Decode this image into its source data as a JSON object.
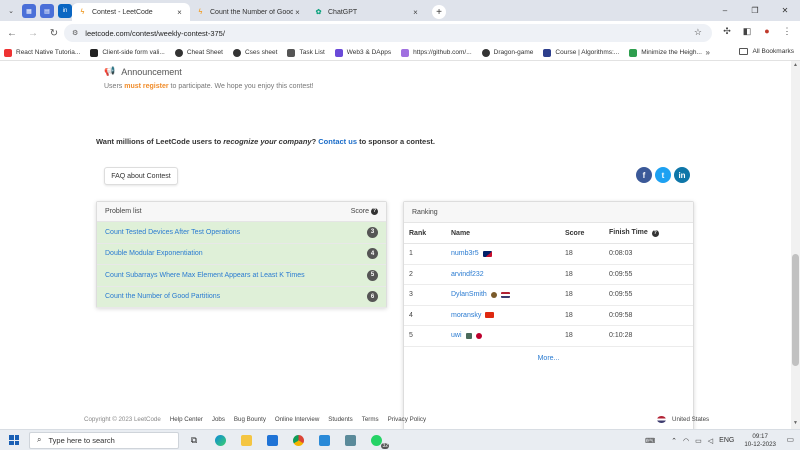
{
  "browser": {
    "tabs": [
      {
        "label": "Contest - LeetCode",
        "active": true
      },
      {
        "label": "Count the Number of Good Pa",
        "active": false
      },
      {
        "label": "ChatGPT",
        "active": false
      }
    ],
    "url": "leetcode.com/contest/weekly-contest-375/",
    "bookmarks": [
      "React Native Tutoria...",
      "Client-side form vali...",
      "Cheat Sheet",
      "Cses sheet",
      "Task List",
      "Web3 & DApps",
      "https://github.com/...",
      "Dragon-game",
      "Course | Algorithms:...",
      "Minimize the Heigh..."
    ],
    "all_bookmarks": "All Bookmarks"
  },
  "announcement": {
    "title": "Announcement",
    "text_before": "Users ",
    "link": "must register",
    "text_after": " to participate. We hope you enjoy this contest!"
  },
  "sponsor": {
    "part1": "Want millions of LeetCode users to ",
    "emph": "recognize your company",
    "part2": "? ",
    "link": "Contact us",
    "part3": " to sponsor a contest."
  },
  "faq_label": "FAQ about Contest",
  "problems": {
    "header": "Problem list",
    "score_header": "Score",
    "items": [
      {
        "name": "Count Tested Devices After Test Operations",
        "score": "3"
      },
      {
        "name": "Double Modular Exponentiation",
        "score": "4"
      },
      {
        "name": "Count Subarrays Where Max Element Appears at Least K Times",
        "score": "5"
      },
      {
        "name": "Count the Number of Good Partitions",
        "score": "6"
      }
    ]
  },
  "ranking": {
    "header": "Ranking",
    "columns": {
      "rank": "Rank",
      "name": "Name",
      "score": "Score",
      "time": "Finish Time"
    },
    "rows": [
      {
        "rank": "1",
        "name": "numb3r5",
        "score": "18",
        "time": "0:08:03"
      },
      {
        "rank": "2",
        "name": "arvindf232",
        "score": "18",
        "time": "0:09:55"
      },
      {
        "rank": "3",
        "name": "DylanSmith",
        "score": "18",
        "time": "0:09:55"
      },
      {
        "rank": "4",
        "name": "moransky",
        "score": "18",
        "time": "0:09:58"
      },
      {
        "rank": "5",
        "name": "uwi",
        "score": "18",
        "time": "0:10:28"
      }
    ],
    "more": "More..."
  },
  "footer": {
    "copyright": "Copyright © 2023 LeetCode",
    "links": [
      "Help Center",
      "Jobs",
      "Bug Bounty",
      "Online Interview",
      "Students",
      "Terms",
      "Privacy Policy"
    ],
    "region": "United States"
  },
  "taskbar": {
    "search_placeholder": "Type here to search",
    "whatsapp_badge": "32",
    "lang": "ENG",
    "time": "09:17",
    "date": "10-12-2023"
  }
}
